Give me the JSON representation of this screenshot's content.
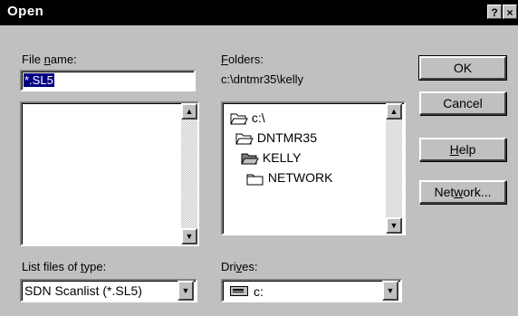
{
  "dialog": {
    "title": "Open",
    "help_btn": "?",
    "close_btn": "×"
  },
  "file_name": {
    "label_pre": "File ",
    "label_ul": "n",
    "label_post": "ame:",
    "value": "*.SL5",
    "list_items": []
  },
  "folders": {
    "label_ul": "F",
    "label_post": "olders:",
    "current_path": "c:\\dntmr35\\kelly",
    "tree": [
      {
        "name": "c:\\",
        "state": "open"
      },
      {
        "name": "DNTMR35",
        "state": "open"
      },
      {
        "name": "KELLY",
        "state": "open-selected"
      },
      {
        "name": "NETWORK",
        "state": "closed"
      }
    ]
  },
  "buttons": {
    "ok": "OK",
    "cancel": "Cancel",
    "help_ul": "H",
    "help_post": "elp",
    "network_pre": "Net",
    "network_ul": "w",
    "network_post": "ork..."
  },
  "file_type": {
    "label_pre": "List files of ",
    "label_ul": "t",
    "label_post": "ype:",
    "value": "SDN Scanlist (*.SL5)"
  },
  "drives": {
    "label_pre": "Dri",
    "label_ul": "v",
    "label_post": "es:",
    "value": "c:"
  },
  "icons": [
    "help-icon",
    "close-icon",
    "scroll-up-icon",
    "scroll-down-icon",
    "dropdown-arrow-icon",
    "folder-open-icon",
    "folder-closed-icon",
    "drive-icon"
  ]
}
